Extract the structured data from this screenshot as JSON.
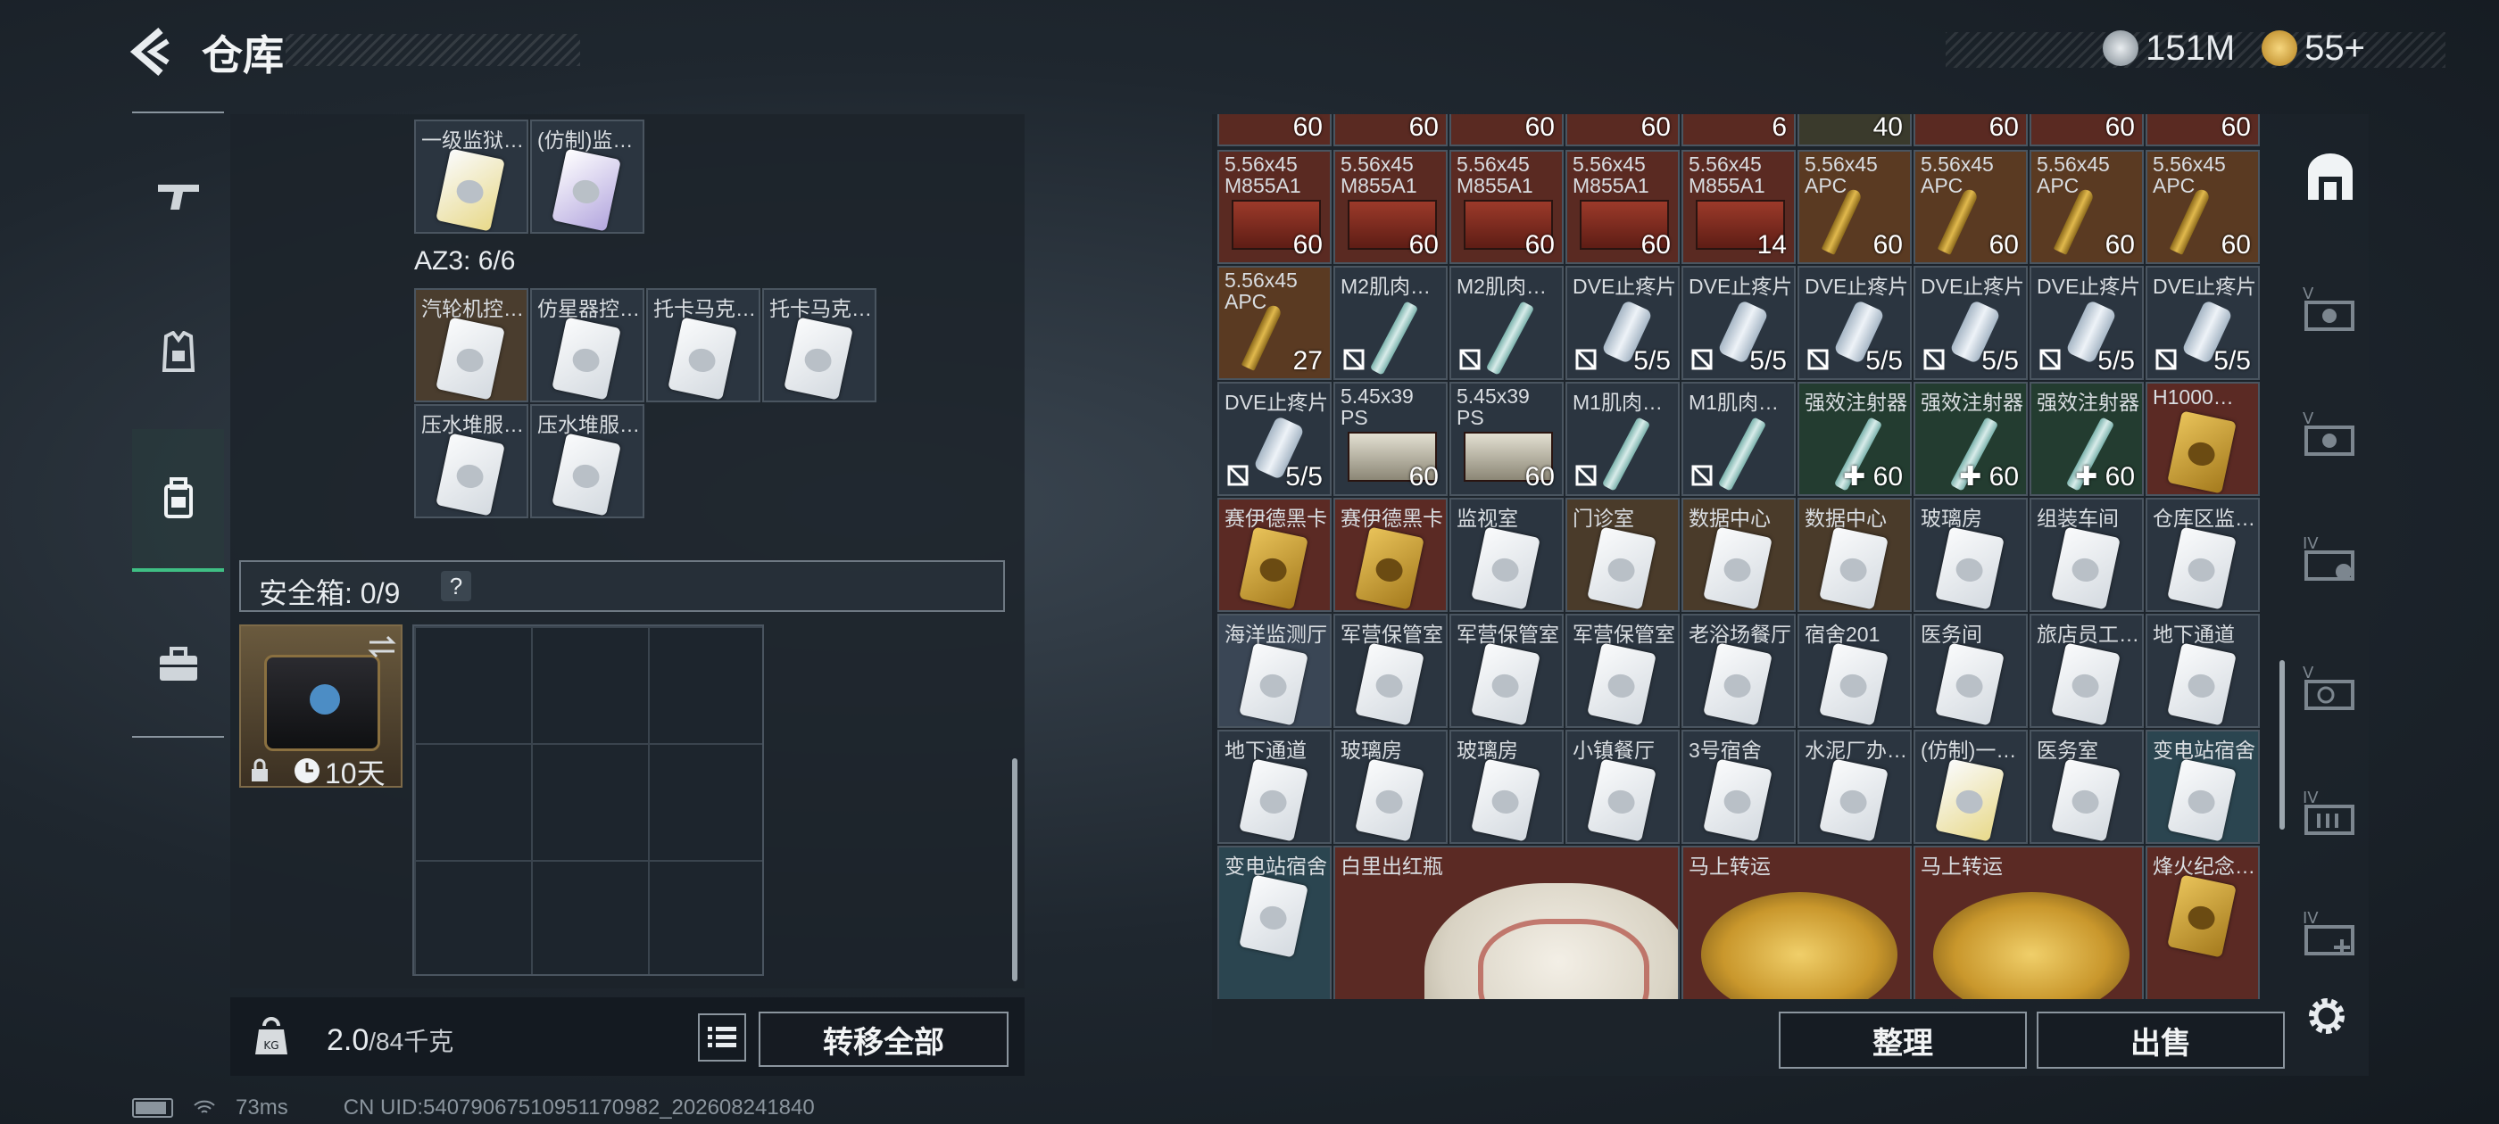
{
  "header": {
    "title": "仓库"
  },
  "currency": [
    {
      "icon": "silver-coin-icon",
      "value": "151M"
    },
    {
      "icon": "gold-coin-icon",
      "value": "55+"
    }
  ],
  "left_tabs": [
    {
      "name": "weapons",
      "icon": "gun-icon"
    },
    {
      "name": "equipment",
      "icon": "armor-vest-icon"
    },
    {
      "name": "backpack",
      "icon": "backpack-icon",
      "active": true
    },
    {
      "name": "briefcase",
      "icon": "briefcase-icon"
    }
  ],
  "container": {
    "top_items": [
      {
        "label": "一级监狱…"
      },
      {
        "label": "(仿制)监…"
      }
    ],
    "section_label": "AZ3: 6/6",
    "az3_items": [
      {
        "label": "汽轮机控…"
      },
      {
        "label": "仿星器控…"
      },
      {
        "label": "托卡马克…"
      },
      {
        "label": "托卡马克…"
      },
      {
        "label": "压水堆服…"
      },
      {
        "label": "压水堆服…"
      }
    ]
  },
  "safe": {
    "label": "安全箱: 0/9",
    "help": "?",
    "timer": "10天"
  },
  "weight": {
    "current": "2.0",
    "max": "/84千克"
  },
  "buttons": {
    "transfer": "转移全部",
    "sort": "整理",
    "sell": "出售"
  },
  "stash": {
    "top_counts": [
      "60",
      "60",
      "60",
      "60",
      "6",
      "40",
      "60",
      "60",
      "60"
    ],
    "rows": [
      [
        {
          "label": "5.56x45 M855A1",
          "count": "60",
          "type": "ammo"
        },
        {
          "label": "5.56x45 M855A1",
          "count": "60",
          "type": "ammo"
        },
        {
          "label": "5.56x45 M855A1",
          "count": "60",
          "type": "ammo"
        },
        {
          "label": "5.56x45 M855A1",
          "count": "60",
          "type": "ammo"
        },
        {
          "label": "5.56x45 M855A1",
          "count": "14",
          "type": "ammo"
        },
        {
          "label": "5.56x45 APC",
          "count": "60",
          "type": "bullet"
        },
        {
          "label": "5.56x45 APC",
          "count": "60",
          "type": "bullet"
        },
        {
          "label": "5.56x45 APC",
          "count": "60",
          "type": "bullet"
        },
        {
          "label": "5.56x45 APC",
          "count": "60",
          "type": "bullet"
        }
      ],
      [
        {
          "label": "5.56x45 APC",
          "count": "27",
          "type": "bullet"
        },
        {
          "label": "M2肌肉…",
          "count": "",
          "type": "syringe"
        },
        {
          "label": "M2肌肉…",
          "count": "",
          "type": "syringe"
        },
        {
          "label": "DVE止疼片",
          "count": "5/5",
          "type": "vial"
        },
        {
          "label": "DVE止疼片",
          "count": "5/5",
          "type": "vial"
        },
        {
          "label": "DVE止疼片",
          "count": "5/5",
          "type": "vial"
        },
        {
          "label": "DVE止疼片",
          "count": "5/5",
          "type": "vial"
        },
        {
          "label": "DVE止疼片",
          "count": "5/5",
          "type": "vial"
        },
        {
          "label": "DVE止疼片",
          "count": "5/5",
          "type": "vial"
        }
      ],
      [
        {
          "label": "DVE止疼片",
          "count": "5/5",
          "type": "vial"
        },
        {
          "label": "5.45x39 PS",
          "count": "60",
          "type": "ammo-gr"
        },
        {
          "label": "5.45x39 PS",
          "count": "60",
          "type": "ammo-gr"
        },
        {
          "label": "M1肌肉…",
          "count": "",
          "type": "syringe"
        },
        {
          "label": "M1肌肉…",
          "count": "",
          "type": "syringe"
        },
        {
          "label": "强效注射器",
          "count": "✚ 60",
          "type": "syringe"
        },
        {
          "label": "强效注射器",
          "count": "✚ 60",
          "type": "syringe"
        },
        {
          "label": "强效注射器",
          "count": "✚ 60",
          "type": "syringe"
        },
        {
          "label": "H1000…",
          "count": "",
          "type": "gold"
        }
      ],
      [
        {
          "label": "赛伊德黑卡",
          "count": "",
          "type": "gold"
        },
        {
          "label": "赛伊德黑卡",
          "count": "",
          "type": "gold"
        },
        {
          "label": "监视室",
          "count": "",
          "type": "card"
        },
        {
          "label": "门诊室",
          "count": "",
          "type": "card"
        },
        {
          "label": "数据中心",
          "count": "",
          "type": "card"
        },
        {
          "label": "数据中心",
          "count": "",
          "type": "card"
        },
        {
          "label": "玻璃房",
          "count": "",
          "type": "card"
        },
        {
          "label": "组装车间",
          "count": "",
          "type": "card"
        },
        {
          "label": "仓库区监…",
          "count": "",
          "type": "card"
        }
      ],
      [
        {
          "label": "海洋监测厅",
          "count": "",
          "type": "card"
        },
        {
          "label": "军营保管室",
          "count": "",
          "type": "card"
        },
        {
          "label": "军营保管室",
          "count": "",
          "type": "card"
        },
        {
          "label": "军营保管室",
          "count": "",
          "type": "card"
        },
        {
          "label": "老浴场餐厅",
          "count": "",
          "type": "card"
        },
        {
          "label": "宿舍201",
          "count": "",
          "type": "card"
        },
        {
          "label": "医务间",
          "count": "",
          "type": "card"
        },
        {
          "label": "旅店员工…",
          "count": "",
          "type": "card"
        },
        {
          "label": "地下通道",
          "count": "",
          "type": "card"
        }
      ],
      [
        {
          "label": "地下通道",
          "count": "",
          "type": "card"
        },
        {
          "label": "玻璃房",
          "count": "",
          "type": "card"
        },
        {
          "label": "玻璃房",
          "count": "",
          "type": "card"
        },
        {
          "label": "小镇餐厅",
          "count": "",
          "type": "card"
        },
        {
          "label": "3号宿舍",
          "count": "",
          "type": "card"
        },
        {
          "label": "水泥厂办…",
          "count": "",
          "type": "card"
        },
        {
          "label": "(仿制)一…",
          "count": "",
          "type": "card-yel"
        },
        {
          "label": "医务室",
          "count": "",
          "type": "card"
        },
        {
          "label": "变电站宿舍",
          "count": "",
          "type": "card"
        }
      ]
    ],
    "bottom_items": [
      {
        "label": "变电站宿舍",
        "type": "card"
      },
      {
        "label": "白里出红瓶",
        "type": "vase"
      },
      {
        "label": "马上转运",
        "type": "coin"
      },
      {
        "label": "马上转运",
        "type": "coin"
      },
      {
        "label": "烽火纪念…",
        "type": "gold"
      }
    ]
  },
  "right_tabs": [
    {
      "name": "tab-all",
      "icon": "stash-home-icon",
      "active": true
    },
    {
      "name": "tab-v-weapons",
      "label": "V",
      "icon": "stash-v-icon"
    },
    {
      "name": "tab-v-ammo",
      "label": "V",
      "icon": "stash-v2-icon"
    },
    {
      "name": "tab-iv-medical",
      "label": "IV",
      "icon": "stash-iv-icon"
    },
    {
      "name": "tab-v-keys",
      "label": "V",
      "icon": "stash-key-icon"
    },
    {
      "name": "tab-iv-folder",
      "label": "IV",
      "icon": "stash-folder-icon"
    },
    {
      "name": "tab-iv-add",
      "label": "IV",
      "icon": "stash-add-icon"
    }
  ],
  "status": {
    "ping": "73ms",
    "uid": "CN UID:540790675109511709​82_202608241840"
  }
}
